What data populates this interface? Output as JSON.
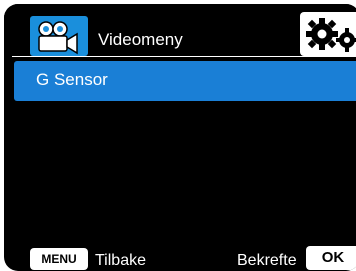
{
  "header": {
    "icon": "camcorder-icon",
    "title": "Videomeny",
    "settings_icon": "gears-icon"
  },
  "menu": {
    "items": [
      {
        "label": "G Sensor",
        "selected": true
      }
    ]
  },
  "footer": {
    "menu_key": "MENU",
    "back_label": "Tilbake",
    "confirm_label": "Bekrefte",
    "ok_key": "OK"
  },
  "colors": {
    "background": "#000000",
    "accent": "#1a8fdc",
    "highlight": "#1a7fd6",
    "text": "#ffffff"
  }
}
